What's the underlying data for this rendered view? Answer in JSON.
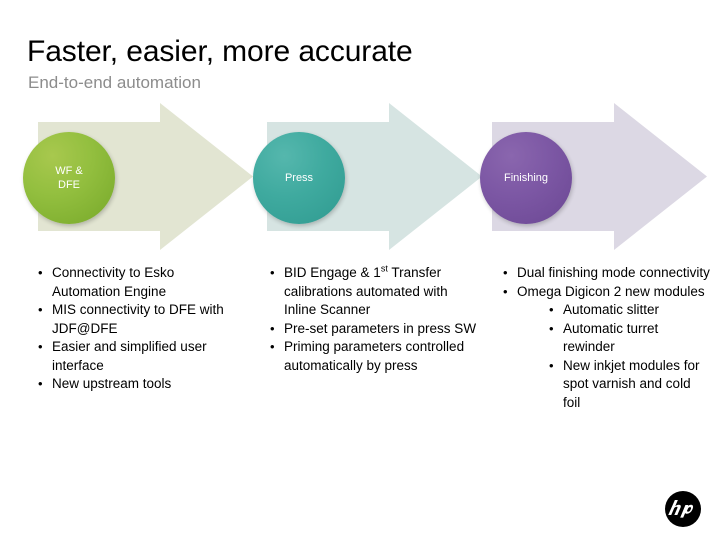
{
  "slide": {
    "title": "Faster, easier, more accurate",
    "subtitle": "End-to-end automation"
  },
  "stages": [
    {
      "id": "wf-dfe",
      "label_line1": "WF &",
      "label_line2": "DFE",
      "circle_color": "#93bf3f",
      "arrow_color": "#e2e5d2"
    },
    {
      "id": "press",
      "label_line1": "Press",
      "label_line2": "",
      "circle_color": "#3faa9f",
      "arrow_color": "#d6e4e2"
    },
    {
      "id": "finishing",
      "label_line1": "Finishing",
      "label_line2": "",
      "circle_color": "#7c57a4",
      "arrow_color": "#dcd8e4"
    }
  ],
  "columns": [
    {
      "id": "wf-dfe-details",
      "bullets": [
        {
          "text": "Connectivity to Esko Automation Engine"
        },
        {
          "text": "MIS connectivity to DFE with JDF@DFE"
        },
        {
          "text": "Easier and simplified user interface"
        },
        {
          "text": "New upstream tools"
        }
      ]
    },
    {
      "id": "press-details",
      "bullets": [
        {
          "text": "BID Engage & 1",
          "ordinal": "st",
          "text_after": " Transfer calibrations automated with Inline Scanner"
        },
        {
          "text": "Pre-set parameters in press SW"
        },
        {
          "text": "Priming parameters controlled automatically by press"
        }
      ]
    },
    {
      "id": "finishing-details",
      "bullets": [
        {
          "text": "Dual finishing mode connectivity"
        },
        {
          "text": "Omega Digicon 2 new modules",
          "sub": [
            "Automatic slitter",
            "Automatic turret rewinder",
            "New inkjet modules for spot varnish and cold foil"
          ]
        }
      ]
    }
  ],
  "branding": {
    "logo": "hp-logo",
    "logo_text": "hp"
  }
}
